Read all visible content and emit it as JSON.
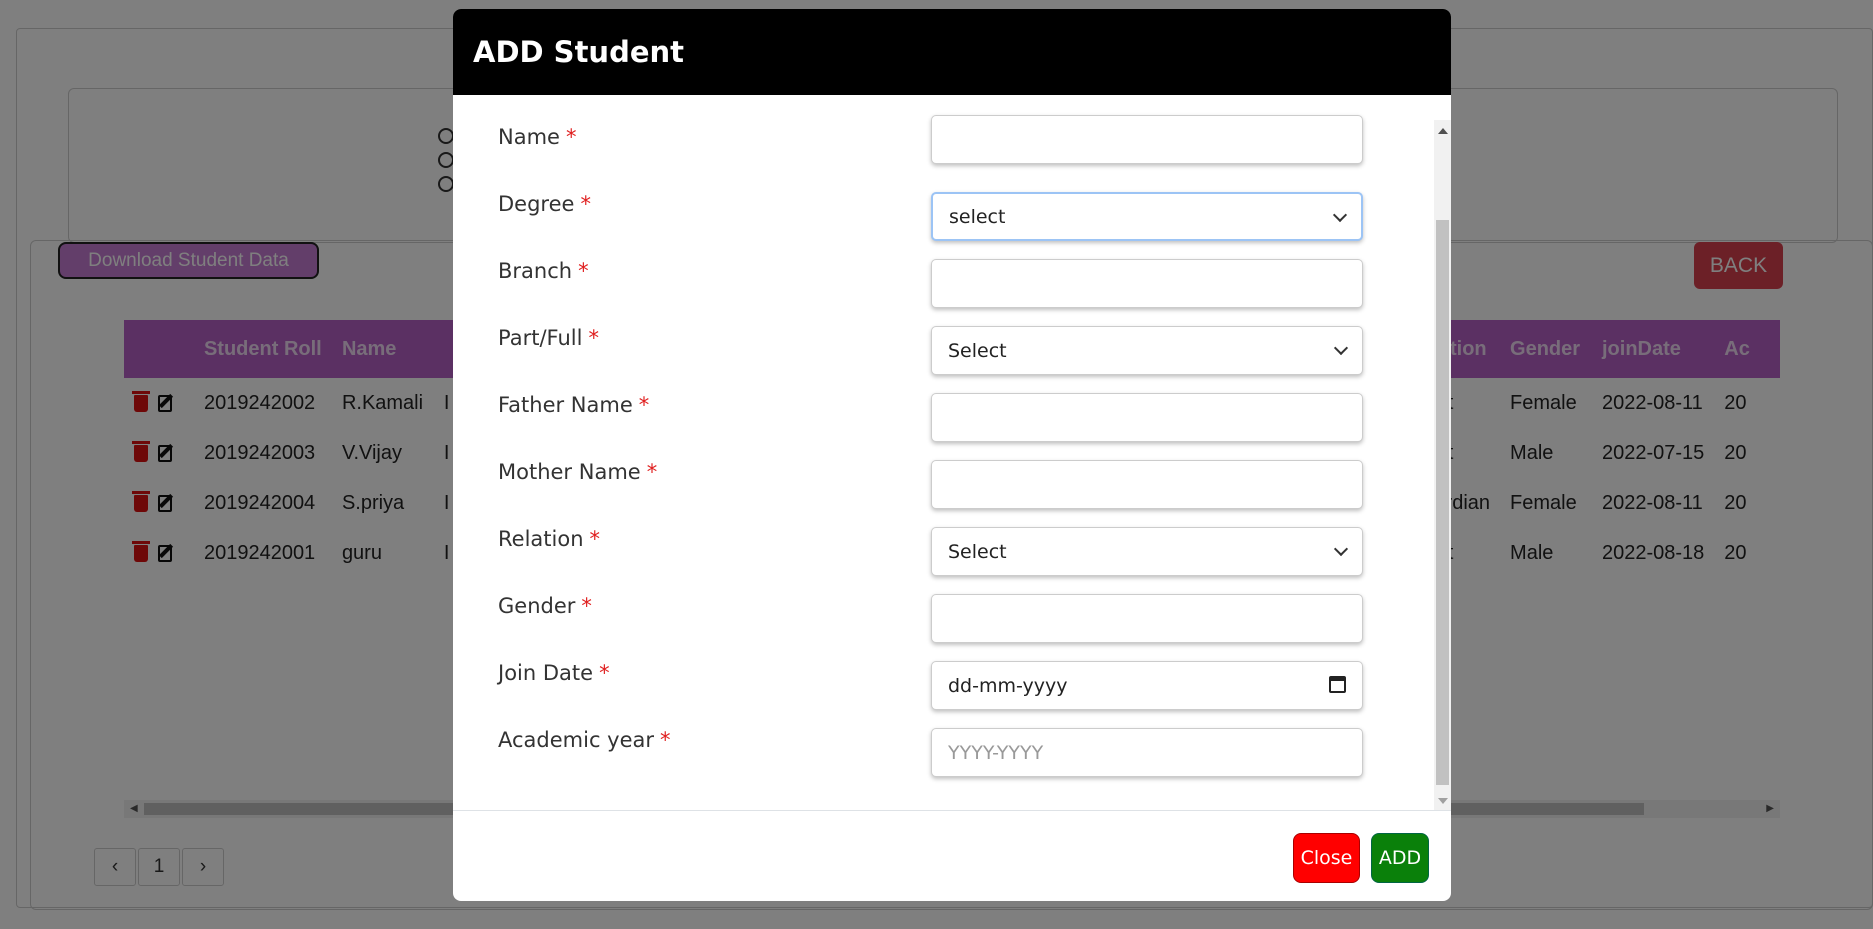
{
  "background": {
    "download_label": "Download Student Data",
    "back_label": "BACK",
    "table": {
      "headers": [
        "",
        "Student Roll",
        "Name",
        "",
        "Relation",
        "Gender",
        "joinDate",
        "Ac"
      ],
      "rows": [
        {
          "roll": "2019242002",
          "name": "R.Kamali",
          "c3": "I",
          "relation": "arent",
          "gender": "Female",
          "join": "2022-08-11",
          "ac": "20"
        },
        {
          "roll": "2019242003",
          "name": "V.Vijay",
          "c3": "I",
          "relation": "arent",
          "gender": "Male",
          "join": "2022-07-15",
          "ac": "20"
        },
        {
          "roll": "2019242004",
          "name": "S.priya",
          "c3": "I",
          "relation": "Guardian",
          "gender": "Female",
          "join": "2022-08-11",
          "ac": "20"
        },
        {
          "roll": "2019242001",
          "name": "guru",
          "c3": "I",
          "relation": "arent",
          "gender": "Male",
          "join": "2022-08-18",
          "ac": "20"
        }
      ]
    },
    "pager": {
      "prev": "‹",
      "page": "1",
      "next": "›"
    }
  },
  "modal": {
    "title": "ADD Student",
    "required_mark": "*",
    "fields": {
      "name": {
        "label": "Name",
        "value": ""
      },
      "degree": {
        "label": "Degree",
        "value": "select"
      },
      "branch": {
        "label": "Branch",
        "value": ""
      },
      "part_full": {
        "label": "Part/Full",
        "value": "Select"
      },
      "father_name": {
        "label": "Father Name",
        "value": ""
      },
      "mother_name": {
        "label": "Mother Name",
        "value": ""
      },
      "relation": {
        "label": "Relation",
        "value": "Select"
      },
      "gender": {
        "label": "Gender",
        "value": ""
      },
      "join_date": {
        "label": "Join Date",
        "value": "dd-mm-yyyy"
      },
      "academic_year": {
        "label": "Academic year",
        "placeholder": "YYYY-YYYY"
      }
    },
    "close_label": "Close",
    "add_label": "ADD"
  },
  "colors": {
    "header_purple": "#b660c6",
    "back_red": "#d9404f",
    "close_red": "#ff0000",
    "add_green": "#0a800a"
  }
}
